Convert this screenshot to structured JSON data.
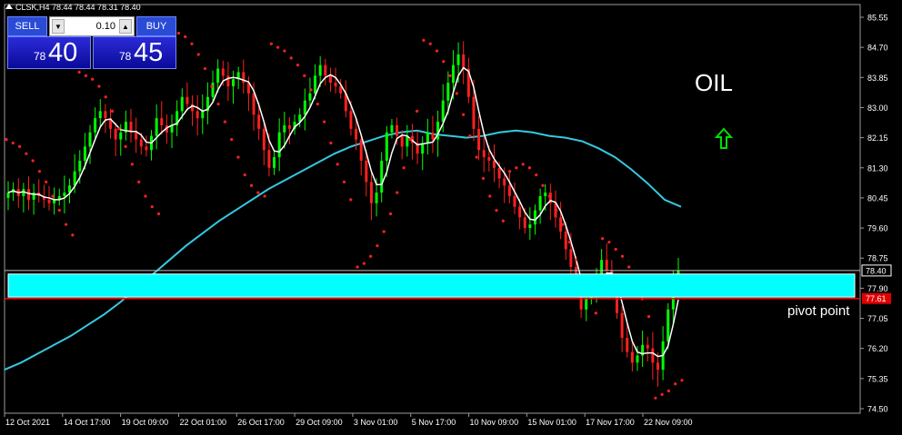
{
  "window": {
    "symbol_info": "CLSK,H4  78.44 78.44 78.31 78.40"
  },
  "trade_panel": {
    "sell_label": "SELL",
    "buy_label": "BUY",
    "lot_value": "0.10",
    "sell_price_small": "78",
    "sell_price_big": "40",
    "buy_price_small": "78",
    "buy_price_big": "45"
  },
  "annotations": {
    "oil_text": "OIL",
    "pivot_text": "pivot point"
  },
  "colors": {
    "background": "#000000",
    "bull": "#00ff00",
    "bear": "#ff2020",
    "sar": "#ff2020",
    "ma_fast": "#ffffff",
    "ma_slow": "#35c9e0",
    "zone": "#00ffff",
    "pivot_line": "#ff0000",
    "arrow": "#00e000"
  },
  "chart_data": {
    "type": "candlestick",
    "price_axis_labels": [
      "85.55",
      "84.70",
      "83.85",
      "83.00",
      "82.15",
      "81.30",
      "80.45",
      "79.60",
      "78.75",
      "77.90",
      "77.05",
      "76.20",
      "75.35",
      "74.50"
    ],
    "price_axis_range": [
      74.5,
      85.55
    ],
    "time_axis_labels": [
      "12 Oct 2021",
      "14 Oct 17:00",
      "19 Oct 09:00",
      "22 Oct 01:00",
      "26 Oct 17:00",
      "29 Oct 09:00",
      "3 Nov 01:00",
      "5 Nov 17:00",
      "10 Nov 09:00",
      "15 Nov 01:00",
      "17 Nov 17:00",
      "22 Nov 09:00"
    ],
    "current_price_label": "78.40",
    "current_price": 78.4,
    "pivot_price_label": "77.61",
    "pivot_price": 77.61,
    "resistance_zone": [
      77.65,
      78.3
    ],
    "close_series": [
      80.6,
      80.7,
      80.5,
      80.7,
      80.4,
      80.6,
      80.5,
      80.4,
      80.3,
      80.4,
      80.5,
      80.6,
      80.8,
      81.2,
      81.5,
      81.9,
      82.3,
      82.7,
      82.9,
      82.7,
      82.4,
      82.1,
      82.3,
      82.6,
      82.3,
      82.1,
      81.9,
      81.8,
      82.2,
      82.7,
      82.5,
      82.3,
      82.5,
      82.9,
      83.3,
      83.1,
      82.9,
      82.7,
      82.9,
      83.3,
      83.7,
      84.1,
      83.9,
      83.6,
      83.8,
      84.0,
      83.7,
      83.4,
      82.8,
      82.4,
      81.8,
      81.3,
      81.6,
      82.3,
      82.5,
      82.4,
      82.6,
      82.8,
      83.2,
      83.4,
      83.9,
      84.2,
      83.9,
      83.7,
      83.6,
      83.4,
      82.9,
      82.4,
      82.1,
      81.5,
      80.9,
      80.3,
      80.6,
      81.5,
      82.3,
      82.5,
      82.2,
      81.9,
      82.2,
      82.0,
      81.7,
      82.0,
      82.3,
      82.1,
      82.6,
      83.2,
      83.7,
      84.2,
      84.5,
      84.1,
      83.3,
      82.4,
      81.8,
      81.6,
      81.5,
      81.3,
      81.0,
      80.8,
      80.5,
      80.2,
      79.9,
      79.6,
      79.7,
      80.1,
      80.5,
      80.6,
      80.3,
      79.9,
      79.5,
      79.0,
      78.5,
      77.9,
      77.3,
      77.6,
      77.9,
      78.3,
      78.7,
      78.4,
      77.9,
      77.2,
      76.5,
      76.1,
      75.8,
      76.0,
      76.3,
      76.2,
      75.8,
      75.6,
      76.4,
      77.3,
      78.2,
      78.4
    ],
    "ma_slow_series": [
      75.6,
      75.8,
      76.05,
      76.3,
      76.55,
      76.85,
      77.15,
      77.5,
      77.9,
      78.3,
      78.7,
      79.1,
      79.45,
      79.8,
      80.1,
      80.4,
      80.7,
      80.95,
      81.2,
      81.45,
      81.7,
      81.9,
      82.05,
      82.2,
      82.3,
      82.35,
      82.25,
      82.2,
      82.15,
      82.2,
      82.3,
      82.35,
      82.3,
      82.2,
      82.15,
      82.05,
      81.85,
      81.6,
      81.25,
      80.85,
      80.4,
      80.2
    ],
    "sar_series": [
      82.1,
      82.0,
      81.9,
      81.7,
      81.5,
      81.2,
      80.9,
      80.5,
      80.1,
      79.7,
      79.4,
      84.0,
      83.9,
      83.8,
      83.6,
      83.3,
      82.9,
      82.4,
      81.9,
      81.4,
      80.9,
      80.5,
      80.2,
      80.0,
      85.3,
      85.2,
      85.1,
      85.0,
      84.8,
      84.5,
      84.1,
      83.6,
      83.1,
      82.6,
      82.1,
      81.6,
      81.1,
      80.8,
      80.6,
      80.5,
      84.8,
      84.7,
      84.6,
      84.4,
      84.2,
      83.9,
      83.5,
      83.1,
      82.6,
      82.0,
      81.4,
      80.9,
      80.4,
      78.5,
      78.6,
      78.8,
      79.1,
      79.5,
      80.0,
      80.6,
      81.3,
      82.1,
      82.9,
      84.9,
      84.8,
      84.6,
      84.3,
      83.9,
      83.4,
      82.8,
      82.2,
      81.6,
      81.0,
      80.5,
      80.1,
      79.8,
      81.2,
      81.3,
      81.4,
      81.3,
      81.1,
      80.8,
      80.5,
      80.1,
      79.7,
      79.2,
      78.7,
      78.2,
      77.7,
      77.2,
      79.3,
      79.2,
      79.0,
      78.8,
      78.5,
      78.1,
      77.6,
      77.1,
      74.8,
      74.9,
      75.0,
      75.2,
      75.3
    ],
    "trend_arrow": "up"
  }
}
